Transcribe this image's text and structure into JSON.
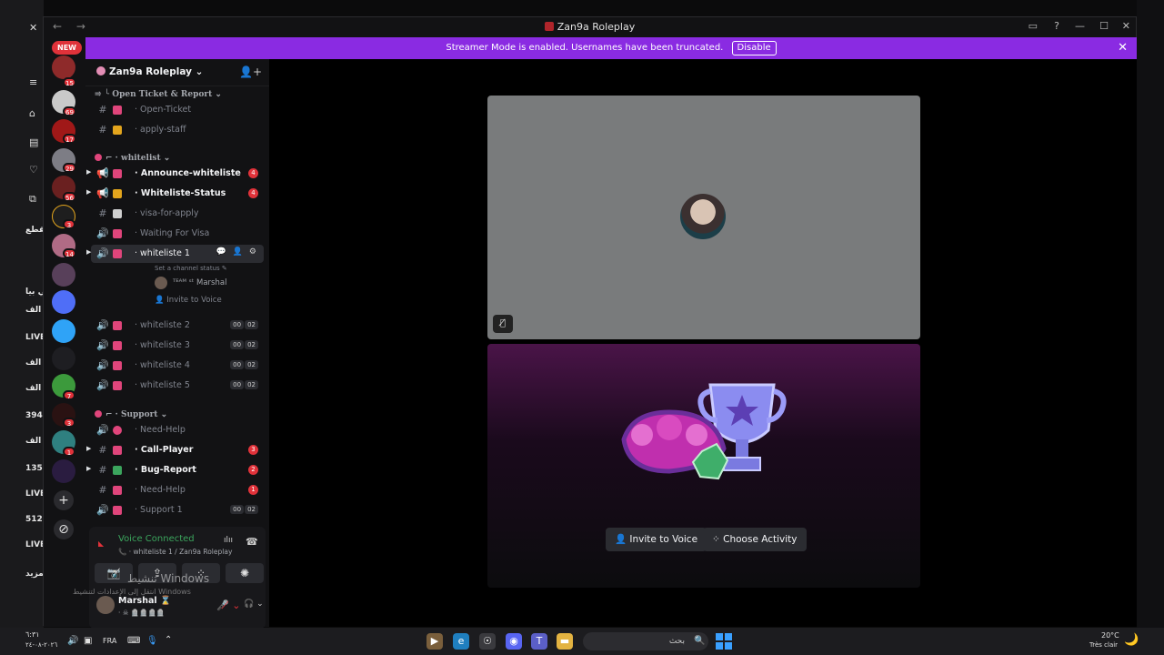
{
  "window": {
    "title": "Zan9a Roleplay",
    "nav": "← →",
    "controls": [
      "▭",
      "?",
      "—",
      "☐",
      "✕"
    ]
  },
  "banner": {
    "text": "Streamer Mode is enabled. Usernames have been truncated.",
    "disable_label": "Disable",
    "close": "✕"
  },
  "rail": {
    "new_label": "NEW",
    "badges": [
      "15",
      "69",
      "17",
      "29",
      "56",
      "3",
      "14",
      "7",
      "3",
      "1"
    ],
    "add_label": "+",
    "discover_label": "⊘"
  },
  "server": {
    "name": "Zan9a Roleplay ⌄",
    "invite_icon": "👤+"
  },
  "categories": {
    "open_ticket": "⥤ ╰ Open Ticket & Report ⌄",
    "whitelist": "⌐ · whitelist ⌄",
    "support": "⌐ · Support ⌄"
  },
  "channels": {
    "open_ticket": {
      "type": "#",
      "label": "· Open-Ticket"
    },
    "apply_staff": {
      "type": "#",
      "label": "· apply-staff"
    },
    "announce": {
      "type": "📢",
      "label": "· Announce-whiteliste",
      "badge": "4"
    },
    "status": {
      "type": "📢",
      "label": "· Whiteliste-Status",
      "badge": "4"
    },
    "visa": {
      "type": "#",
      "label": "· visa-for-apply"
    },
    "waiting": {
      "type": "🔊",
      "label": "· Waiting For Visa"
    },
    "wl1": {
      "type": "🔊",
      "label": "· whiteliste 1",
      "tools": "💬 👤 ⚙"
    },
    "wl1_status": "Set a channel status ✎",
    "wl1_member": "ᵀᴱᴬᴹ ˢᵗ Marshal",
    "wl1_invite": "Invite to Voice",
    "wl2": {
      "type": "🔊",
      "label": "· whiteliste 2",
      "c1": "00",
      "c2": "02"
    },
    "wl3": {
      "type": "🔊",
      "label": "· whiteliste 3",
      "c1": "00",
      "c2": "02"
    },
    "wl4": {
      "type": "🔊",
      "label": "· whiteliste 4",
      "c1": "00",
      "c2": "02"
    },
    "wl5": {
      "type": "🔊",
      "label": "· whiteliste 5",
      "c1": "00",
      "c2": "02"
    },
    "need_help": {
      "type": "🔊",
      "label": "· Need-Help"
    },
    "call_player": {
      "type": "#",
      "label": "· Call-Player",
      "badge": "3"
    },
    "bug_report": {
      "type": "#",
      "label": "· Bug-Report",
      "badge": "2"
    },
    "need_help2": {
      "type": "#",
      "label": "· Need-Help",
      "badge": "1"
    },
    "support1": {
      "type": "🔊",
      "label": "· Support 1",
      "c1": "00",
      "c2": "02"
    }
  },
  "voice": {
    "status": "Voice Connected",
    "sub": "📞 · whiteliste 1 / Zan9a Roleplay",
    "soundboard": "ılıı",
    "disconnect": "☎"
  },
  "user": {
    "name": "Marshal ⌛",
    "sub": "· ☠ 🪦🪦🪦🪦",
    "controls": [
      "🎤̸ ⌄",
      "🎧 ⌄",
      "⚙"
    ]
  },
  "watermark": {
    "line1": "تنشيط Windows",
    "line2": "انتقل إلى الإعدادات لتنشيط Windows"
  },
  "stage": {
    "invite_label": "Invite to Voice",
    "activity_label": "Choose Activity"
  },
  "bg_left": {
    "labels": [
      "مقطع",
      "بي بيا",
      "ك ألف",
      "LIVE",
      "ك ألف",
      "ألف",
      "394",
      "ألف",
      "135",
      "LIVE",
      "512",
      "LIVE",
      "المزيد"
    ]
  },
  "taskbar": {
    "time": "٦:٣١",
    "date": "٢٠٢٦-٠٨-٢٤",
    "lang": "FRA",
    "search_placeholder": "بحث",
    "temp": "20°C",
    "weather": "Très clair"
  },
  "colors": {
    "banner": "#8a2be2",
    "badge": "#e0323a",
    "voice_green": "#3ba55d"
  }
}
